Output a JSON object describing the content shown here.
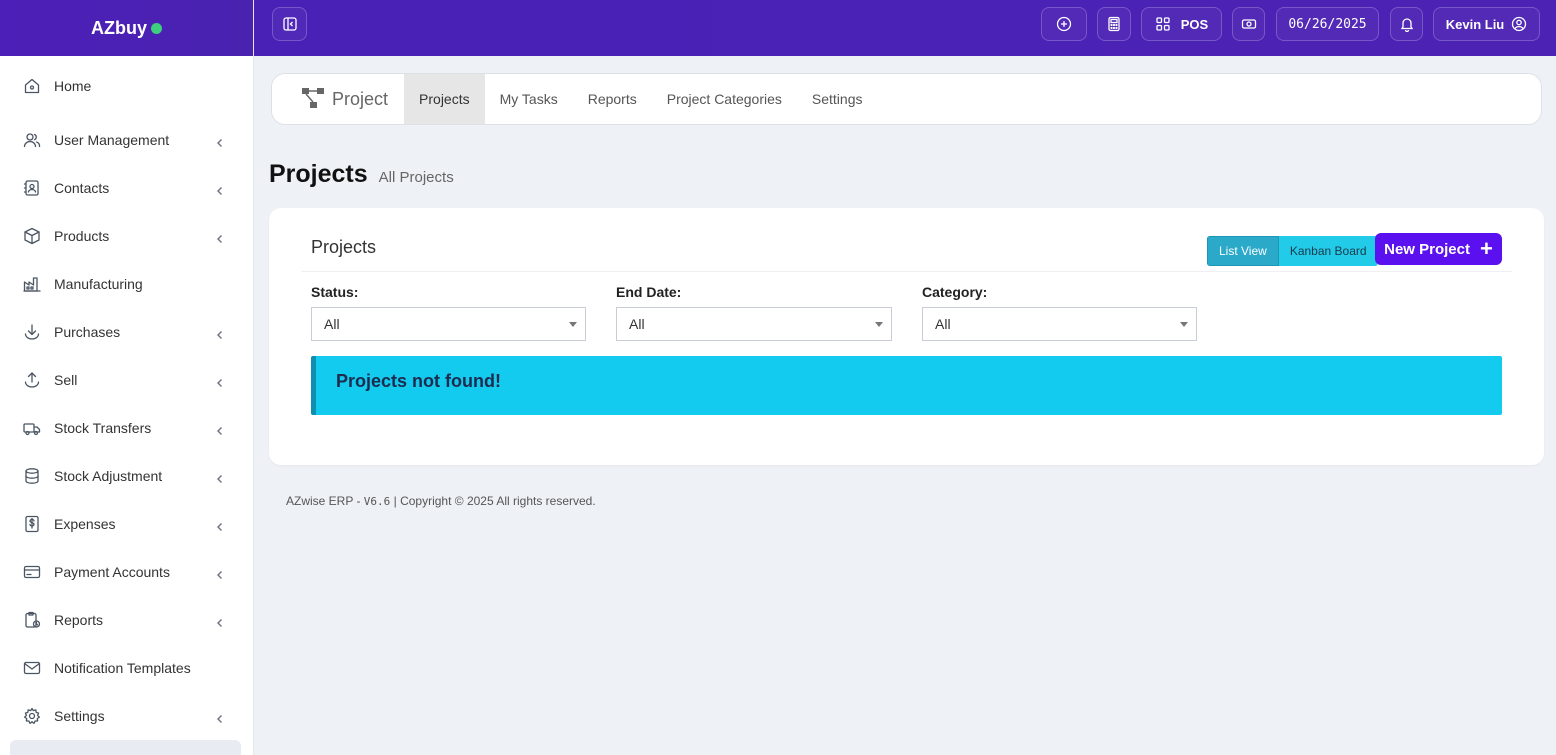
{
  "brand": {
    "name": "AZbuy",
    "status_color": "#3ecf7e"
  },
  "sidebar": {
    "items": [
      {
        "label": "Home",
        "icon": "home-icon",
        "has_children": false
      },
      {
        "label": "User Management",
        "icon": "users-icon",
        "has_children": true
      },
      {
        "label": "Contacts",
        "icon": "contacts-icon",
        "has_children": true
      },
      {
        "label": "Products",
        "icon": "box-icon",
        "has_children": true
      },
      {
        "label": "Manufacturing",
        "icon": "factory-icon",
        "has_children": false
      },
      {
        "label": "Purchases",
        "icon": "download-icon",
        "has_children": true
      },
      {
        "label": "Sell",
        "icon": "upload-icon",
        "has_children": true
      },
      {
        "label": "Stock Transfers",
        "icon": "truck-icon",
        "has_children": true
      },
      {
        "label": "Stock Adjustment",
        "icon": "database-icon",
        "has_children": true
      },
      {
        "label": "Expenses",
        "icon": "dollar-file-icon",
        "has_children": true
      },
      {
        "label": "Payment Accounts",
        "icon": "credit-card-icon",
        "has_children": true
      },
      {
        "label": "Reports",
        "icon": "clipboard-clock-icon",
        "has_children": true
      },
      {
        "label": "Notification Templates",
        "icon": "mail-icon",
        "has_children": false
      },
      {
        "label": "Settings",
        "icon": "gear-icon",
        "has_children": true
      }
    ]
  },
  "topbar": {
    "pos_label": "POS",
    "date": "06/26/2025",
    "user_name": "Kevin Liu",
    "accent": "#4a21b6"
  },
  "module_tabs": {
    "brand_label": "Project",
    "tabs": [
      "Projects",
      "My Tasks",
      "Reports",
      "Project Categories",
      "Settings"
    ],
    "active_index": 0
  },
  "page": {
    "title": "Projects",
    "subtitle": "All Projects"
  },
  "card": {
    "title": "Projects",
    "view_toggle": {
      "list": "List View",
      "kanban": "Kanban Board"
    },
    "new_button": "New Project",
    "filters": [
      {
        "label": "Status:",
        "value": "All"
      },
      {
        "label": "End Date:",
        "value": "All"
      },
      {
        "label": "Category:",
        "value": "All"
      }
    ],
    "alert": "Projects not found!",
    "alert_color": "#12cbee"
  },
  "footer": {
    "app": "AZwise ERP - ",
    "version": "V6.6",
    "copyright": " | Copyright © 2025 All rights reserved."
  }
}
